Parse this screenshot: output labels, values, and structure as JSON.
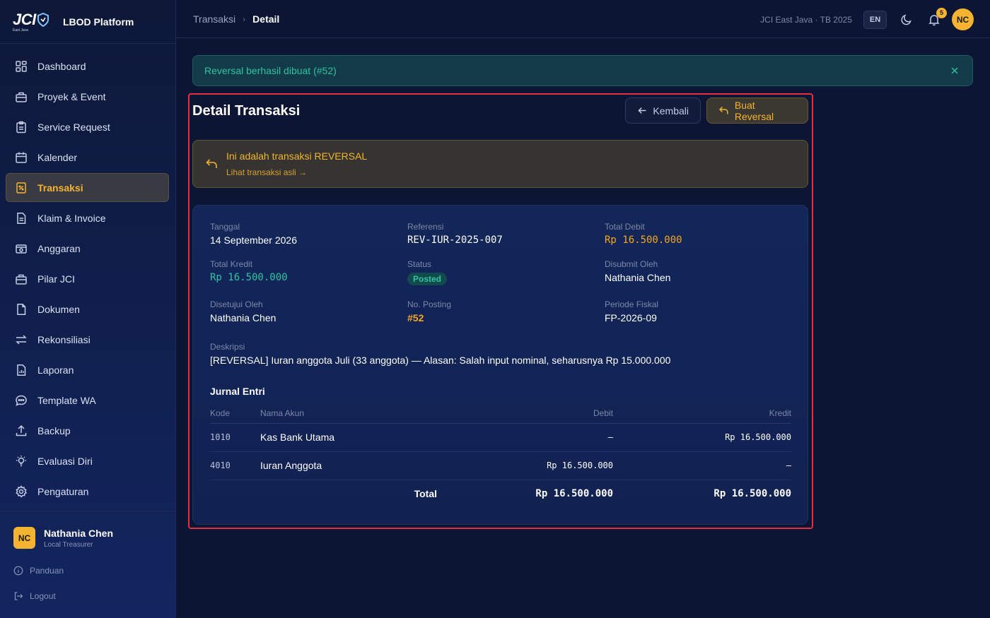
{
  "brand": {
    "logo_text": "JCI",
    "logo_sub": "East Java",
    "name": "LBOD Platform"
  },
  "sidebar": {
    "items": [
      {
        "label": "Dashboard",
        "icon": "dashboard-icon"
      },
      {
        "label": "Proyek & Event",
        "icon": "briefcase-icon"
      },
      {
        "label": "Service Request",
        "icon": "clipboard-icon"
      },
      {
        "label": "Kalender",
        "icon": "calendar-icon"
      },
      {
        "label": "Transaksi",
        "icon": "receipt-icon",
        "active": true
      },
      {
        "label": "Klaim & Invoice",
        "icon": "file-text-icon"
      },
      {
        "label": "Anggaran",
        "icon": "wallet-icon"
      },
      {
        "label": "Pilar JCI",
        "icon": "briefcase-icon"
      },
      {
        "label": "Dokumen",
        "icon": "file-icon"
      },
      {
        "label": "Rekonsiliasi",
        "icon": "swap-icon"
      },
      {
        "label": "Laporan",
        "icon": "report-icon"
      },
      {
        "label": "Template WA",
        "icon": "chat-icon"
      },
      {
        "label": "Backup",
        "icon": "upload-icon"
      },
      {
        "label": "Evaluasi Diri",
        "icon": "bulb-icon"
      },
      {
        "label": "Pengaturan",
        "icon": "gear-icon"
      }
    ]
  },
  "user": {
    "initials": "NC",
    "name": "Nathania Chen",
    "role": "Local Treasurer"
  },
  "links": {
    "guide": "Panduan",
    "logout": "Logout"
  },
  "topbar": {
    "crumb_root": "Transaksi",
    "crumb_current": "Detail",
    "org": "JCI East Java · TB 2025",
    "lang": "EN",
    "notif_count": "5",
    "avatar": "NC"
  },
  "alert": {
    "message": "Reversal berhasil dibuat (#52)"
  },
  "detail": {
    "title": "Detail Transaksi",
    "back_label": "Kembali",
    "reverse_label": "Buat Reversal",
    "banner_title": "Ini adalah transaksi REVERSAL",
    "banner_link": "Lihat transaksi asli →"
  },
  "fields": {
    "date_label": "Tanggal",
    "date": "14 September 2026",
    "ref_label": "Referensi",
    "ref": "REV-IUR-2025-007",
    "debit_label": "Total Debit",
    "debit": "Rp 16.500.000",
    "credit_label": "Total Kredit",
    "credit": "Rp 16.500.000",
    "status_label": "Status",
    "status": "Posted",
    "submitted_label": "Disubmit Oleh",
    "submitted": "Nathania Chen",
    "approved_label": "Disetujui Oleh",
    "approved": "Nathania Chen",
    "posting_label": "No. Posting",
    "posting": "#52",
    "period_label": "Periode Fiskal",
    "period": "FP-2026-09",
    "desc_label": "Deskripsi",
    "desc": "[REVERSAL] Iuran anggota Juli (33 anggota) — Alasan: Salah input nominal, seharusnya Rp 15.000.000"
  },
  "journal": {
    "title": "Jurnal Entri",
    "columns": [
      "Kode",
      "Nama Akun",
      "Debit",
      "Kredit"
    ],
    "rows": [
      {
        "code": "1010",
        "account": "Kas Bank Utama",
        "debit": "–",
        "credit": "Rp 16.500.000"
      },
      {
        "code": "4010",
        "account": "Iuran Anggota",
        "debit": "Rp 16.500.000",
        "credit": "–"
      }
    ],
    "total_label": "Total",
    "total_debit": "Rp 16.500.000",
    "total_credit": "Rp 16.500.000"
  },
  "colors": {
    "accent": "#f5b332",
    "teal": "#2fc4a0",
    "highlight": "#e0323c"
  }
}
